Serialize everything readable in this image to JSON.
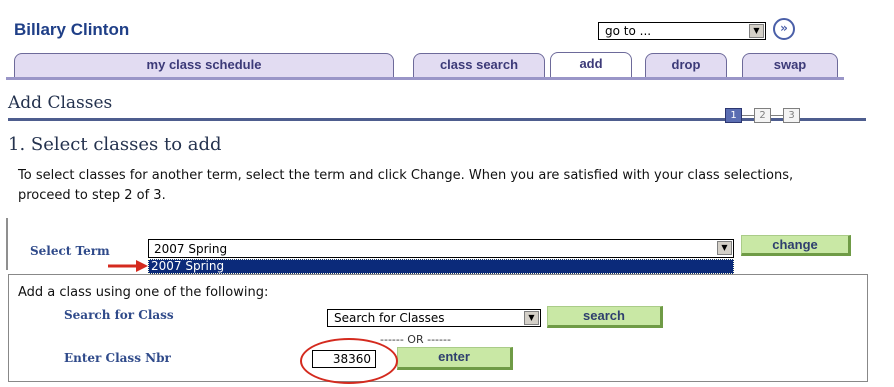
{
  "header": {
    "student_name": "Billary Clinton",
    "goto_value": "go to ...",
    "go_button": "»"
  },
  "tabs": [
    {
      "label": "my class schedule",
      "active": false
    },
    {
      "label": "class search",
      "active": false
    },
    {
      "label": "add",
      "active": true
    },
    {
      "label": "drop",
      "active": false
    },
    {
      "label": "swap",
      "active": false
    }
  ],
  "page": {
    "title": "Add Classes",
    "steps": [
      "1",
      "2",
      "3"
    ],
    "current_step": 1,
    "section_title": "1. Select classes to add",
    "instructions": "To select classes for another term, select the term and click Change. When you are satisfied with your class selections, proceed to step 2 of 3."
  },
  "term": {
    "label": "Select Term",
    "selected": "2007 Spring",
    "option_highlighted": "2007 Spring",
    "change_button": "change"
  },
  "add_class": {
    "heading": "Add a class using one of the following:",
    "search_label": "Search for Class",
    "search_select": "Search for Classes",
    "search_button": "search",
    "or_text": "------ OR ------",
    "classnbr_label": "Enter Class Nbr",
    "classnbr_value": "38360",
    "enter_button": "enter"
  },
  "colors": {
    "accent_blue": "#1f3f87",
    "tab_bg": "#e2dcf2",
    "button_green": "#c9e8a5",
    "highlight_navy": "#0b2a7a",
    "annotation_red": "#d42a1e"
  }
}
